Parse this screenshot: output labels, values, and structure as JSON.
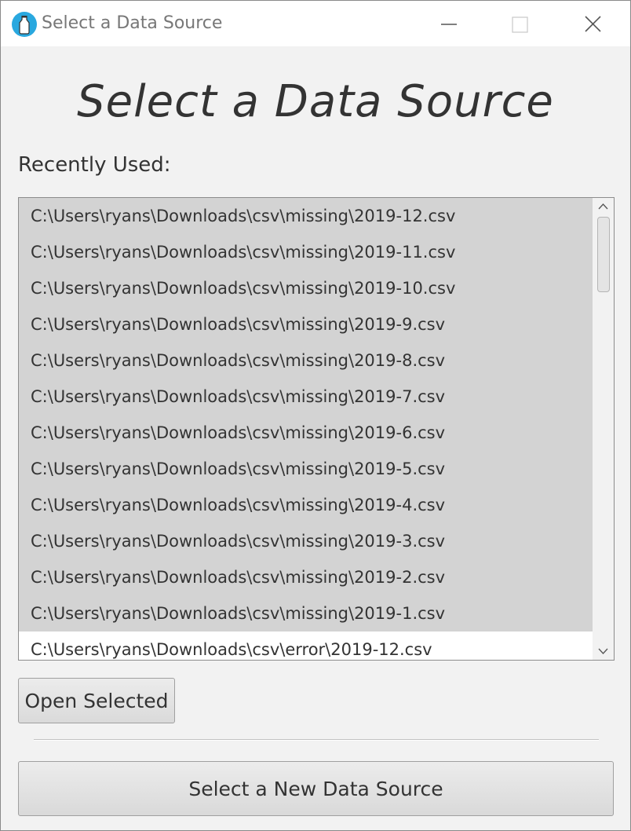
{
  "window": {
    "title": "Select a Data Source",
    "app_icon": "milk-bottle-icon",
    "controls": {
      "minimize_icon": "minimize-icon",
      "maximize_icon": "maximize-icon",
      "close_icon": "close-icon"
    }
  },
  "main": {
    "heading": "Select a Data Source",
    "recent_label": "Recently Used:",
    "recent_files": [
      {
        "path": "C:\\Users\\ryans\\Downloads\\csv\\missing\\2019-12.csv",
        "highlighted": true
      },
      {
        "path": "C:\\Users\\ryans\\Downloads\\csv\\missing\\2019-11.csv",
        "highlighted": true
      },
      {
        "path": "C:\\Users\\ryans\\Downloads\\csv\\missing\\2019-10.csv",
        "highlighted": true
      },
      {
        "path": "C:\\Users\\ryans\\Downloads\\csv\\missing\\2019-9.csv",
        "highlighted": true
      },
      {
        "path": "C:\\Users\\ryans\\Downloads\\csv\\missing\\2019-8.csv",
        "highlighted": true
      },
      {
        "path": "C:\\Users\\ryans\\Downloads\\csv\\missing\\2019-7.csv",
        "highlighted": true
      },
      {
        "path": "C:\\Users\\ryans\\Downloads\\csv\\missing\\2019-6.csv",
        "highlighted": true
      },
      {
        "path": "C:\\Users\\ryans\\Downloads\\csv\\missing\\2019-5.csv",
        "highlighted": true
      },
      {
        "path": "C:\\Users\\ryans\\Downloads\\csv\\missing\\2019-4.csv",
        "highlighted": true
      },
      {
        "path": "C:\\Users\\ryans\\Downloads\\csv\\missing\\2019-3.csv",
        "highlighted": true
      },
      {
        "path": "C:\\Users\\ryans\\Downloads\\csv\\missing\\2019-2.csv",
        "highlighted": true
      },
      {
        "path": "C:\\Users\\ryans\\Downloads\\csv\\missing\\2019-1.csv",
        "highlighted": true
      },
      {
        "path": "C:\\Users\\ryans\\Downloads\\csv\\error\\2019-12.csv",
        "highlighted": false
      }
    ],
    "open_selected_label": "Open Selected",
    "new_source_label": "Select a New Data Source"
  },
  "colors": {
    "highlight_row": "#d3d3d3",
    "app_icon": "#29a8df"
  }
}
